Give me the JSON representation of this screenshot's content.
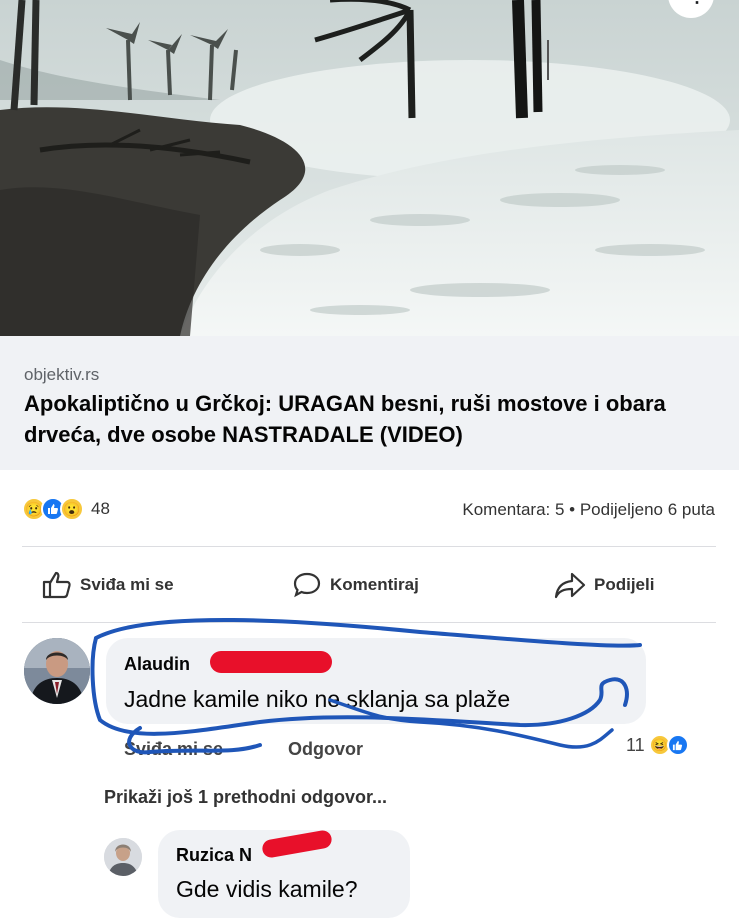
{
  "link": {
    "domain": "objektiv.rs",
    "title": "Apokaliptično u Grčkoj: URAGAN besni, ruši mostove i obara drveća, dve osobe NASTRADALE (VIDEO)"
  },
  "stats": {
    "reaction_count": "48",
    "reactions": [
      "sad-emoji-icon",
      "like-icon",
      "wow-emoji-icon"
    ],
    "comments_shares": "Komentara: 5 • Podijeljeno 6 puta"
  },
  "actions": {
    "like": "Sviđa mi se",
    "comment": "Komentiraj",
    "share": "Podijeli"
  },
  "comment1": {
    "author": "Alaudin",
    "text": "Jadne kamile niko ne sklanja sa plaže",
    "like": "Sviđa mi se",
    "reply": "Odgovor",
    "reaction_count": "11"
  },
  "more_replies": "Prikaži još 1 prethodni odgovor...",
  "comment2": {
    "author": "Ruzica N",
    "text": "Gde vidis kamile?"
  },
  "colors": {
    "accent": "#1877f2",
    "bubble": "#f0f2f5",
    "redaction": "#e8102a",
    "scribble": "#1f56b8"
  }
}
